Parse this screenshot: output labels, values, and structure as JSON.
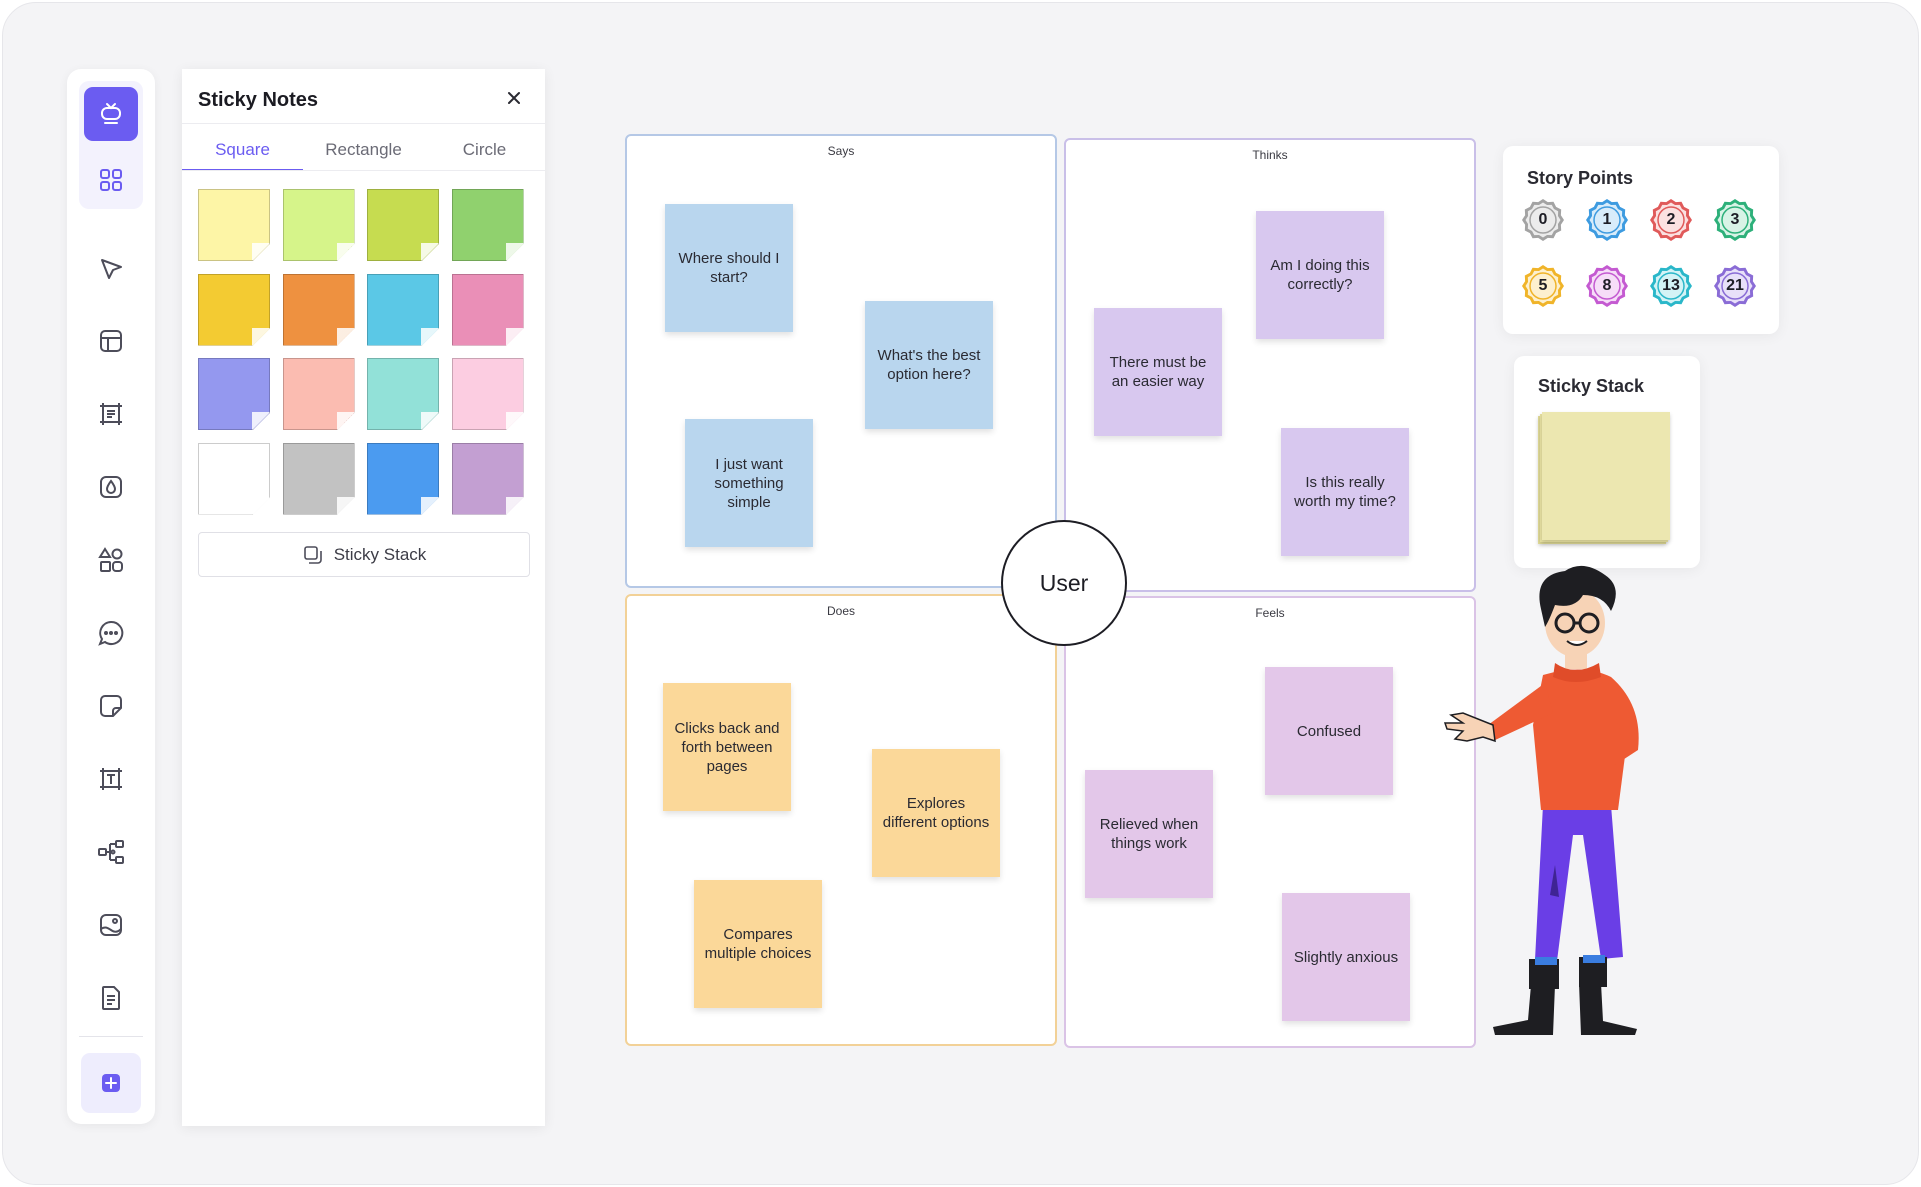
{
  "toolbar": {
    "items": [
      {
        "name": "templates",
        "icon": "template-icon"
      },
      {
        "name": "apps",
        "icon": "grid-icon"
      },
      {
        "name": "select",
        "icon": "cursor-icon"
      },
      {
        "name": "layouts",
        "icon": "layout-icon"
      },
      {
        "name": "frame",
        "icon": "frame-icon"
      },
      {
        "name": "color",
        "icon": "droplet-icon"
      },
      {
        "name": "shapes",
        "icon": "shapes-icon"
      },
      {
        "name": "comment",
        "icon": "comment-icon"
      },
      {
        "name": "sticky-note",
        "icon": "sticky-note-icon"
      },
      {
        "name": "text",
        "icon": "text-icon"
      },
      {
        "name": "mind-map",
        "icon": "mindmap-icon"
      },
      {
        "name": "image",
        "icon": "image-icon"
      },
      {
        "name": "document",
        "icon": "document-icon"
      },
      {
        "name": "add",
        "icon": "plus-icon"
      }
    ],
    "accent": "#6b5cf1"
  },
  "panel": {
    "title": "Sticky Notes",
    "tabs": [
      "Square",
      "Rectangle",
      "Circle"
    ],
    "active_tab": "Square",
    "swatches": [
      "#fdf5a6",
      "#d6f48a",
      "#c6dc50",
      "#90d16e",
      "#f3cb32",
      "#ee9140",
      "#5bc8e6",
      "#ea8fb7",
      "#9498ef",
      "#fbbcb1",
      "#92e1d8",
      "#fccde1",
      "#ffffff",
      "#c2c2c2",
      "#4b9bf0",
      "#c39fd2"
    ],
    "stack_button": "Sticky Stack"
  },
  "board": {
    "center_label": "User",
    "quadrants": {
      "says": {
        "label": "Says",
        "notes": [
          "Where should I start?",
          "What's the best option here?",
          "I just want something simple"
        ]
      },
      "thinks": {
        "label": "Thinks",
        "notes": [
          "Am I doing this correctly?",
          "There must be an easier way",
          "Is this really worth my time?"
        ]
      },
      "does": {
        "label": "Does",
        "notes": [
          "Clicks back and forth between pages",
          "Explores different options",
          "Compares multiple choices"
        ]
      },
      "feels": {
        "label": "Feels",
        "notes": [
          "Confused",
          "Relieved when things work",
          "Slightly anxious"
        ]
      }
    }
  },
  "story_points": {
    "title": "Story Points",
    "values": [
      "0",
      "1",
      "2",
      "3",
      "5",
      "8",
      "13",
      "21"
    ],
    "colors": [
      "#a3a3a3",
      "#3d9be0",
      "#e05a5a",
      "#2db07a",
      "#f0b429",
      "#c45ad1",
      "#2ab7c9",
      "#8a6cd6"
    ],
    "fills": [
      "#ececec",
      "#d8ecfa",
      "#fbe1e1",
      "#d8f3e6",
      "#fdf0cf",
      "#f6ddf8",
      "#d3f3f6",
      "#e8e0f9"
    ]
  },
  "sticky_stack": {
    "title": "Sticky Stack"
  }
}
